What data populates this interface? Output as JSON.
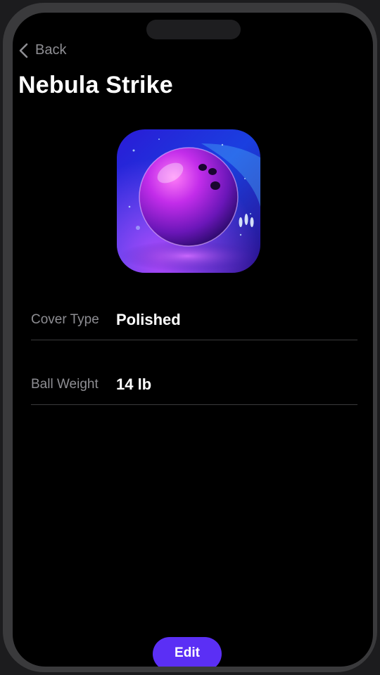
{
  "nav": {
    "back_label": "Back"
  },
  "ball": {
    "name": "Nebula Strike",
    "image_icon": "bowling-ball-image"
  },
  "details": [
    {
      "label": "Cover Type",
      "value": "Polished"
    },
    {
      "label": "Ball Weight",
      "value": "14 lb"
    }
  ],
  "actions": {
    "edit_label": "Edit"
  },
  "colors": {
    "accent": "#5b2ff5",
    "background": "#000000",
    "label": "#8e8e93",
    "value": "#ffffff"
  }
}
